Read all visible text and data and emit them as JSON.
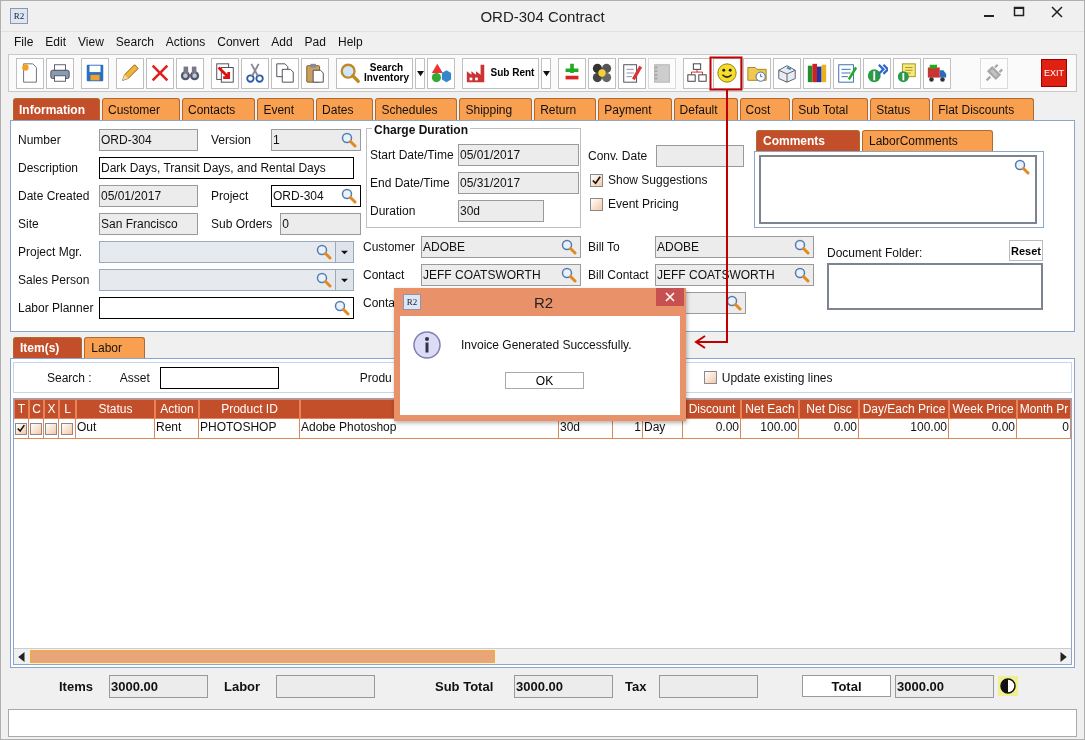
{
  "window": {
    "title": "ORD-304 Contract",
    "icon_text": "R2"
  },
  "menu": [
    "File",
    "Edit",
    "View",
    "Search",
    "Actions",
    "Convert",
    "Add",
    "Pad",
    "Help"
  ],
  "toolbar": [
    [
      {
        "kind": "icon",
        "disabled": false
      },
      {
        "kind": "icon",
        "disabled": false
      }
    ],
    [
      {
        "kind": "icon",
        "disabled": false
      }
    ],
    [
      {
        "kind": "icon",
        "disabled": false
      },
      {
        "kind": "icon",
        "disabled": false
      },
      {
        "kind": "icon",
        "disabled": false
      }
    ],
    [
      {
        "kind": "icon",
        "disabled": false
      },
      {
        "kind": "icon",
        "disabled": false
      },
      {
        "kind": "icon",
        "disabled": false
      },
      {
        "kind": "icon",
        "disabled": false
      }
    ],
    [
      {
        "kind": "labeled",
        "label": "Search Inventory",
        "disabled": false
      },
      {
        "kind": "dropdown",
        "disabled": false
      },
      {
        "kind": "icon",
        "disabled": false
      }
    ],
    [
      {
        "kind": "labeled",
        "label": "Sub Rent",
        "disabled": false
      },
      {
        "kind": "dropdown",
        "disabled": false
      }
    ],
    [
      {
        "kind": "icon",
        "disabled": false
      },
      {
        "kind": "icon",
        "disabled": false
      },
      {
        "kind": "icon",
        "disabled": false
      },
      {
        "kind": "icon",
        "disabled": true
      }
    ],
    [
      {
        "kind": "icon",
        "disabled": false
      },
      {
        "kind": "icon",
        "disabled": false
      },
      {
        "kind": "icon",
        "disabled": false
      },
      {
        "kind": "icon",
        "disabled": false
      },
      {
        "kind": "icon",
        "disabled": false
      },
      {
        "kind": "icon",
        "disabled": false
      },
      {
        "kind": "icon",
        "disabled": false
      },
      {
        "kind": "icon",
        "disabled": false
      },
      {
        "kind": "icon",
        "disabled": false
      }
    ],
    [
      {
        "kind": "icon",
        "disabled": true
      }
    ],
    [
      {
        "kind": "exit",
        "label": "EXIT",
        "disabled": false
      }
    ]
  ],
  "tabs": [
    {
      "label": "Information",
      "selected": true
    },
    {
      "label": "Customer",
      "selected": false
    },
    {
      "label": "Contacts",
      "selected": false
    },
    {
      "label": "Event",
      "selected": false
    },
    {
      "label": "Dates",
      "selected": false
    },
    {
      "label": "Schedules",
      "selected": false
    },
    {
      "label": "Shipping",
      "selected": false
    },
    {
      "label": "Return",
      "selected": false
    },
    {
      "label": "Payment",
      "selected": false
    },
    {
      "label": "Default",
      "selected": false
    },
    {
      "label": "Cost",
      "selected": false
    },
    {
      "label": "Sub Total",
      "selected": false
    },
    {
      "label": "Status",
      "selected": false
    },
    {
      "label": "Flat Discounts",
      "selected": false
    }
  ],
  "info": {
    "rows": [
      [
        {
          "label": "Number",
          "value": "ORD-304",
          "kind": "text",
          "readonly": true
        },
        {
          "label": "Version",
          "value": "1",
          "kind": "lookup",
          "readonly": true
        }
      ],
      [
        {
          "label": "Description",
          "value": "Dark Days, Transit Days, and Rental Days",
          "kind": "text",
          "readonly": false
        }
      ],
      [
        {
          "label": "Date Created",
          "value": "05/01/2017",
          "kind": "text",
          "readonly": true
        },
        {
          "label": "Project",
          "value": "ORD-304",
          "kind": "lookup",
          "readonly": false
        }
      ],
      [
        {
          "label": "Site",
          "value": "San Francisco",
          "kind": "text",
          "readonly": true
        },
        {
          "label": "Sub Orders",
          "value": "0",
          "kind": "text",
          "readonly": true
        }
      ],
      [
        {
          "label": "Project Mgr.",
          "kind": "combo",
          "readonly": true
        }
      ],
      [
        {
          "label": "Sales Person",
          "kind": "combo",
          "readonly": true
        }
      ],
      [
        {
          "label": "Labor Planner",
          "kind": "lookup",
          "readonly": false
        }
      ]
    ],
    "charge_duration": {
      "title": "Charge Duration",
      "fields": [
        {
          "label": "Start Date/Time",
          "value": "05/01/2017",
          "readonly": true
        },
        {
          "label": "End Date/Time",
          "value": "05/31/2017",
          "readonly": true
        },
        {
          "label": "Duration",
          "value": "30d",
          "readonly": true
        }
      ]
    },
    "conv_date": {
      "label": "Conv. Date",
      "readonly": true
    },
    "options": [
      {
        "label": "Show Suggestions",
        "checked": true
      },
      {
        "label": "Event Pricing",
        "checked": false
      }
    ],
    "comments": {
      "tabs": [
        {
          "label": "Comments",
          "selected": true
        },
        {
          "label": "LaborComments",
          "selected": false
        }
      ]
    },
    "parties": [
      [
        {
          "label": "Customer",
          "value": "ADOBE",
          "kind": "lookup",
          "readonly": true
        },
        {
          "label": "Bill To",
          "value": "ADOBE",
          "kind": "lookup",
          "readonly": true
        }
      ],
      [
        {
          "label": "Contact",
          "value": "JEFF COATSWORTH",
          "kind": "lookup",
          "readonly": true
        },
        {
          "label": "Bill Contact",
          "value": "JEFF COATSWORTH",
          "kind": "lookup",
          "readonly": true
        }
      ],
      [
        {
          "label": "Conta",
          "kind": "none"
        },
        {
          "kind": "lookup",
          "readonly": true
        }
      ]
    ],
    "document_folder": {
      "label": "Document Folder:",
      "button": "Reset"
    }
  },
  "items_tabs": [
    {
      "label": "Item(s)",
      "selected": true
    },
    {
      "label": "Labor",
      "selected": false
    }
  ],
  "items_search": {
    "label": "Search :",
    "asset_label": "Asset",
    "product_label": "Produ",
    "update_label": "Update existing lines",
    "update_checked": false
  },
  "table": {
    "flag_columns": [
      "T",
      "C",
      "X",
      "L"
    ],
    "columns": [
      {
        "label": "Status"
      },
      {
        "label": "Action"
      },
      {
        "label": "Product ID"
      },
      {},
      {},
      {},
      {},
      {
        "label": "Discount"
      },
      {
        "label": "Net Each"
      },
      {
        "label": "Net Disc"
      },
      {
        "label": "Day/Each Price"
      },
      {
        "label": "Week Price"
      },
      {
        "label": "Month Pr"
      }
    ],
    "rows": [
      {
        "flags": [
          true,
          false,
          false,
          false
        ],
        "cells": [
          "Out",
          "Rent",
          "PHOTOSHOP",
          "Adobe Photoshop",
          "30d",
          "1",
          "Day",
          "0.00",
          "100.00",
          "0.00",
          "100.00",
          "0.00",
          "0"
        ]
      }
    ]
  },
  "totals": [
    {
      "label": "Items",
      "value": "3000.00",
      "kind": "plain"
    },
    {
      "label": "Labor",
      "kind": "plain"
    },
    {
      "label": "Sub Total",
      "value": "3000.00",
      "kind": "plain"
    },
    {
      "label": "Tax",
      "kind": "plain"
    },
    {
      "label": "Total",
      "value": "3000.00",
      "kind": "grand"
    }
  ],
  "dialog": {
    "title": "R2",
    "icon_text": "R2",
    "message": "Invoice Generated Successfully.",
    "button": "OK"
  }
}
